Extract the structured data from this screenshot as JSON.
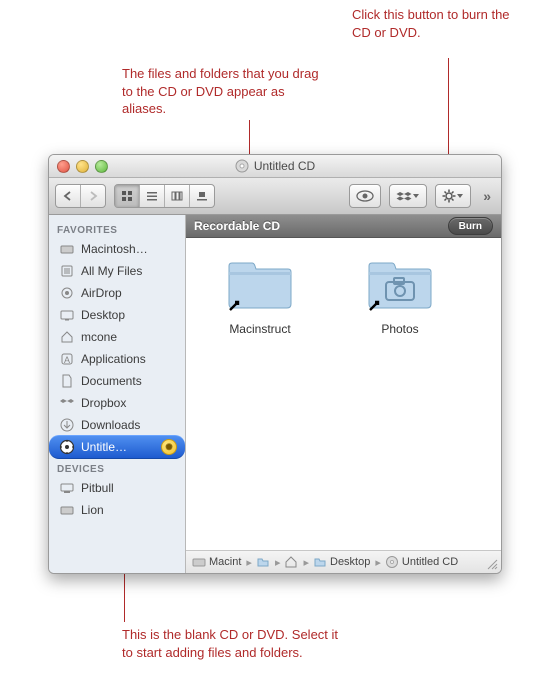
{
  "callouts": {
    "top_right": "Click this button to burn the CD or DVD.",
    "top_center": "The files and folders that you drag to the CD or DVD appear as aliases.",
    "bottom": "This is the blank CD or DVD. Select it to start adding files and folders."
  },
  "window": {
    "title": "Untitled CD",
    "header": "Recordable CD",
    "burn_label": "Burn"
  },
  "sidebar": {
    "favorites_label": "FAVORITES",
    "devices_label": "DEVICES",
    "favorites": [
      {
        "label": "Macintosh…"
      },
      {
        "label": "All My Files"
      },
      {
        "label": "AirDrop"
      },
      {
        "label": "Desktop"
      },
      {
        "label": "mcone"
      },
      {
        "label": "Applications"
      },
      {
        "label": "Documents"
      },
      {
        "label": "Dropbox"
      },
      {
        "label": "Downloads"
      },
      {
        "label": "Untitle…"
      }
    ],
    "devices": [
      {
        "label": "Pitbull"
      },
      {
        "label": "Lion"
      }
    ]
  },
  "files": [
    {
      "name": "Macinstruct",
      "type": "folder-alias"
    },
    {
      "name": "Photos",
      "type": "folder-alias-photos"
    }
  ],
  "pathbar": [
    {
      "label": "Macint"
    },
    {
      "label": ""
    },
    {
      "label": ""
    },
    {
      "label": "Desktop"
    },
    {
      "label": "Untitled CD"
    }
  ]
}
